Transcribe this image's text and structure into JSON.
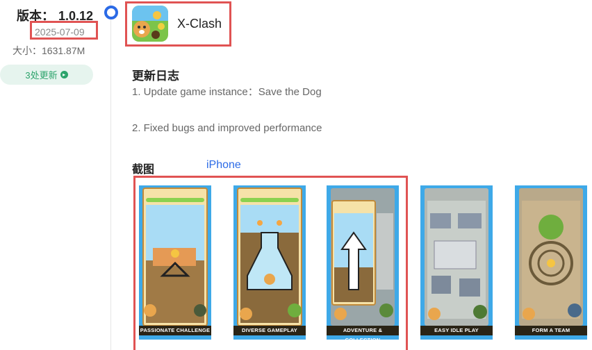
{
  "version": {
    "label": "版本：",
    "number": "1.0.12"
  },
  "release_date": "2025-07-09",
  "size": "大小：1631.87M",
  "updates_button": {
    "label": "3处更新",
    "icon": "arrow-right-circle-icon"
  },
  "app": {
    "name": "X-Clash",
    "icon": "x-clash-app-icon"
  },
  "changelog": {
    "title": "更新日志",
    "items": [
      "1. Update game instance：Save the Dog",
      "2. Fixed bugs and improved performance"
    ]
  },
  "screenshots": {
    "title": "截图",
    "platform_tab": "iPhone",
    "items": [
      {
        "caption": "PASSIONATE CHALLENGE"
      },
      {
        "caption": "DIVERSE GAMEPLAY"
      },
      {
        "caption": "ADVENTURE & COLLECTION"
      },
      {
        "caption": "EASY IDLE PLAY"
      },
      {
        "caption": "FORM A TEAM"
      }
    ]
  },
  "colors": {
    "highlight_border": "#e05353",
    "accent_blue": "#2b6ae6",
    "update_green": "#2ca36b"
  }
}
